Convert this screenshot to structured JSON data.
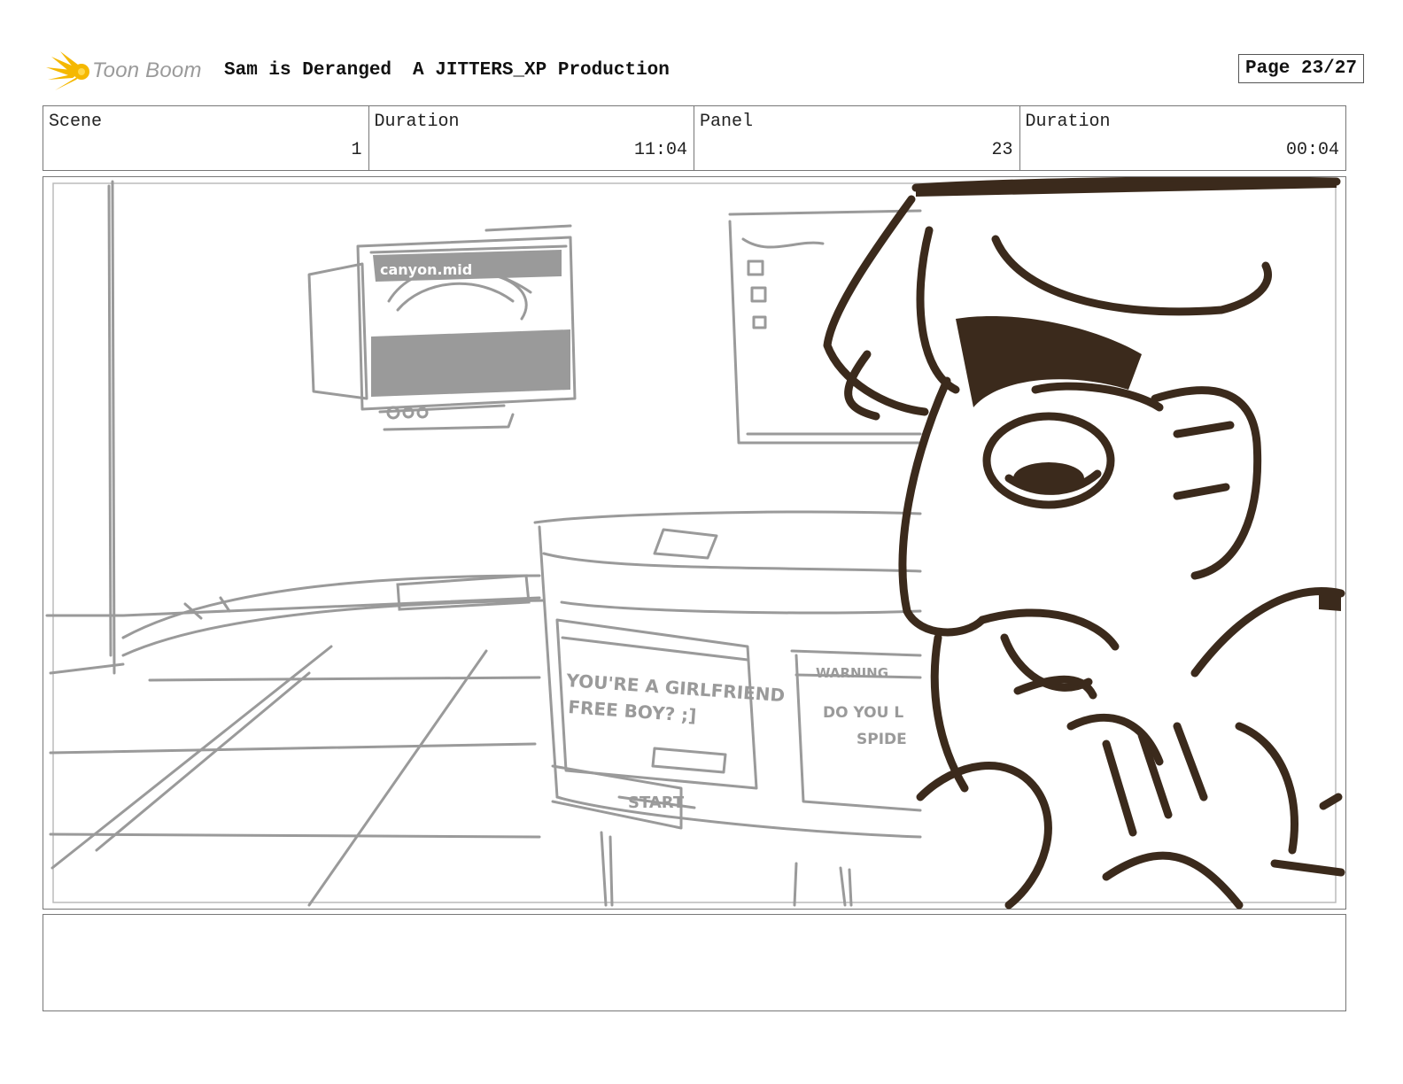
{
  "header": {
    "logo_text": "Toon Boom",
    "project_title": "Sam is Deranged",
    "production": "A JITTERS_XP Production",
    "page": "Page 23/27"
  },
  "info": {
    "scene_label": "Scene",
    "scene_value": "1",
    "scene_duration_label": "Duration",
    "scene_duration_value": "11:04",
    "panel_label": "Panel",
    "panel_value": "23",
    "panel_duration_label": "Duration",
    "panel_duration_value": "00:04"
  },
  "panel_sketch": {
    "monitor_text": "canyon.mid",
    "popup_text_1": "YOU'RE A GIRLFRIEND",
    "popup_text_2": "FREE BOY? ;]",
    "warning_text": "WARNING",
    "warning_body_1": "DO YOU L",
    "warning_body_2": "SPIDE",
    "taskbar_text": "START"
  },
  "notes": {
    "text": ""
  },
  "colors": {
    "sketch_gray": "#9a9a9a",
    "character_ink": "#3b2a1c",
    "logo_yellow": "#f5b800"
  }
}
